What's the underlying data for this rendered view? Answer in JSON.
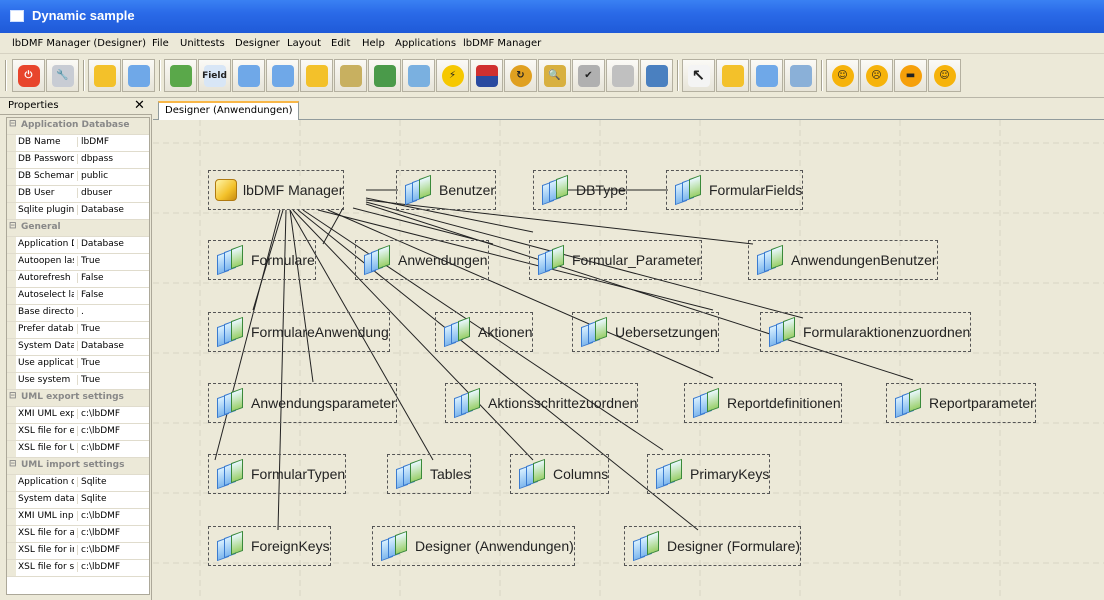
{
  "window": {
    "title": "Dynamic sample"
  },
  "menu": [
    "lbDMF Manager (Designer)",
    "File",
    "Unittests",
    "Designer",
    "Layout",
    "Edit",
    "Help",
    "Applications",
    "lbDMF Manager"
  ],
  "toolbar": {
    "buttons": [
      {
        "icon": "power-icon",
        "color": "#e8452c"
      },
      {
        "icon": "wrench-icon",
        "color": "#b8bcc4"
      },
      {
        "icon": "new-cube-icon",
        "color": "#f3c12a"
      },
      {
        "icon": "tables-icon",
        "color": "#6fa8e8"
      },
      {
        "icon": "users-icon",
        "color": "#5aa84a"
      },
      {
        "icon": "field-icon",
        "color": "#d8e6f6",
        "label": "Field"
      },
      {
        "icon": "form-icon",
        "color": "#6fa8e8"
      },
      {
        "icon": "forms-icon",
        "color": "#6fa8e8"
      },
      {
        "icon": "cube-icon",
        "color": "#f3c12a"
      },
      {
        "icon": "tools-icon",
        "color": "#c8b060"
      },
      {
        "icon": "chart-icon",
        "color": "#4a9a4a"
      },
      {
        "icon": "table-edit-icon",
        "color": "#7ab0e0"
      },
      {
        "icon": "action-icon",
        "color": "#f6c800"
      },
      {
        "icon": "flags-icon",
        "color": "#d03030"
      },
      {
        "icon": "refresh-icon",
        "color": "#e0a020"
      },
      {
        "icon": "magnify-icon",
        "color": "#d8b040"
      },
      {
        "icon": "check-icon",
        "color": "#a0a0a0"
      },
      {
        "icon": "print-icon",
        "color": "#c0c0c0"
      },
      {
        "icon": "layout-icon",
        "color": "#4a80c0"
      },
      {
        "icon": "pointer-icon",
        "color": "#f4f4f4"
      },
      {
        "icon": "cube2-icon",
        "color": "#f3c12a"
      },
      {
        "icon": "tables2-icon",
        "color": "#6fa8e8"
      },
      {
        "icon": "tables3-icon",
        "color": "#8ab0d8"
      },
      {
        "icon": "smiley-happy-icon",
        "color": "#f6b30a"
      },
      {
        "icon": "smiley-sad-icon",
        "color": "#f6b30a"
      },
      {
        "icon": "smiley-cool-icon",
        "color": "#f6a00a"
      },
      {
        "icon": "smiley-neutral-icon",
        "color": "#f6b30a"
      }
    ]
  },
  "properties": {
    "title": "Properties",
    "close": "✕",
    "rows": [
      {
        "section": true,
        "toggle": "⊟",
        "label": "Application Database"
      },
      {
        "key": "DB Name",
        "value": "lbDMF"
      },
      {
        "key": "DB Password",
        "value": "dbpass"
      },
      {
        "key": "DB Schemaname",
        "value": "public"
      },
      {
        "key": "DB User",
        "value": "dbuser"
      },
      {
        "key": "Sqlite plugin name",
        "value": "Database"
      },
      {
        "section": true,
        "toggle": "⊟",
        "label": "General"
      },
      {
        "key": "Application Database",
        "value": "Database"
      },
      {
        "key": "Autoopen last",
        "value": "True"
      },
      {
        "key": "Autorefresh updated",
        "value": "False"
      },
      {
        "key": "Autoselect last",
        "value": "False"
      },
      {
        "key": "Base directory",
        "value": "."
      },
      {
        "key": "Prefer database",
        "value": "True"
      },
      {
        "key": "System Database",
        "value": "Database"
      },
      {
        "key": "Use application",
        "value": "True"
      },
      {
        "key": "Use system Db",
        "value": "True"
      },
      {
        "section": true,
        "toggle": "⊟",
        "label": "UML export settings"
      },
      {
        "key": "XMI UML export",
        "value": "c:\\lbDMF"
      },
      {
        "key": "XSL file for export",
        "value": "c:\\lbDMF"
      },
      {
        "key": "XSL file for UML",
        "value": "c:\\lbDMF"
      },
      {
        "section": true,
        "toggle": "⊟",
        "label": "UML import settings"
      },
      {
        "key": "Application database",
        "value": "Sqlite"
      },
      {
        "key": "System database",
        "value": "Sqlite"
      },
      {
        "key": "XMI UML input",
        "value": "c:\\lbDMF"
      },
      {
        "key": "XSL file for app",
        "value": "c:\\lbDMF"
      },
      {
        "key": "XSL file for import",
        "value": "c:\\lbDMF"
      },
      {
        "key": "XSL file for sys",
        "value": "c:\\lbDMF"
      }
    ]
  },
  "tab": {
    "label": "Designer (Anwendungen)"
  },
  "designer": {
    "nodes": [
      {
        "id": "manager",
        "label": "lbDMF Manager",
        "icon": "cube-icon"
      },
      {
        "id": "benutzer",
        "label": "Benutzer",
        "icon": "table-icon"
      },
      {
        "id": "dbtype",
        "label": "DBType",
        "icon": "table-icon"
      },
      {
        "id": "formularfields",
        "label": "FormularFields",
        "icon": "table-icon"
      },
      {
        "id": "formulare",
        "label": "Formulare",
        "icon": "table-icon"
      },
      {
        "id": "anwendungen",
        "label": "Anwendungen",
        "icon": "table-icon"
      },
      {
        "id": "formular_parameter",
        "label": "Formular_Parameter",
        "icon": "table-icon"
      },
      {
        "id": "anwendungenbenutzer",
        "label": "AnwendungenBenutzer",
        "icon": "table-icon"
      },
      {
        "id": "formulareanwendung",
        "label": "FormulareAnwendung",
        "icon": "table-icon"
      },
      {
        "id": "aktionen",
        "label": "Aktionen",
        "icon": "table-icon"
      },
      {
        "id": "uebersetzungen",
        "label": "Uebersetzungen",
        "icon": "table-icon"
      },
      {
        "id": "formularaktionenzuordnen",
        "label": "Formularaktionenzuordnen",
        "icon": "table-icon"
      },
      {
        "id": "anwendungsparameter",
        "label": "Anwendungsparameter",
        "icon": "table-icon"
      },
      {
        "id": "aktionsschrittezuordnen",
        "label": "Aktionsschrittezuordnen",
        "icon": "table-icon"
      },
      {
        "id": "reportdefinitionen",
        "label": "Reportdefinitionen",
        "icon": "table-icon"
      },
      {
        "id": "reportparameter",
        "label": "Reportparameter",
        "icon": "table-icon"
      },
      {
        "id": "formulartypen",
        "label": "FormularTypen",
        "icon": "table-icon"
      },
      {
        "id": "tables",
        "label": "Tables",
        "icon": "table-icon"
      },
      {
        "id": "columns",
        "label": "Columns",
        "icon": "table-icon"
      },
      {
        "id": "primarykeys",
        "label": "PrimaryKeys",
        "icon": "table-icon"
      },
      {
        "id": "foreignkeys",
        "label": "ForeignKeys",
        "icon": "table-icon"
      },
      {
        "id": "designer_anwendungen",
        "label": "Designer (Anwendungen)",
        "icon": "table-icon"
      },
      {
        "id": "designer_formulare",
        "label": "Designer (Formulare)",
        "icon": "table-icon"
      }
    ]
  }
}
